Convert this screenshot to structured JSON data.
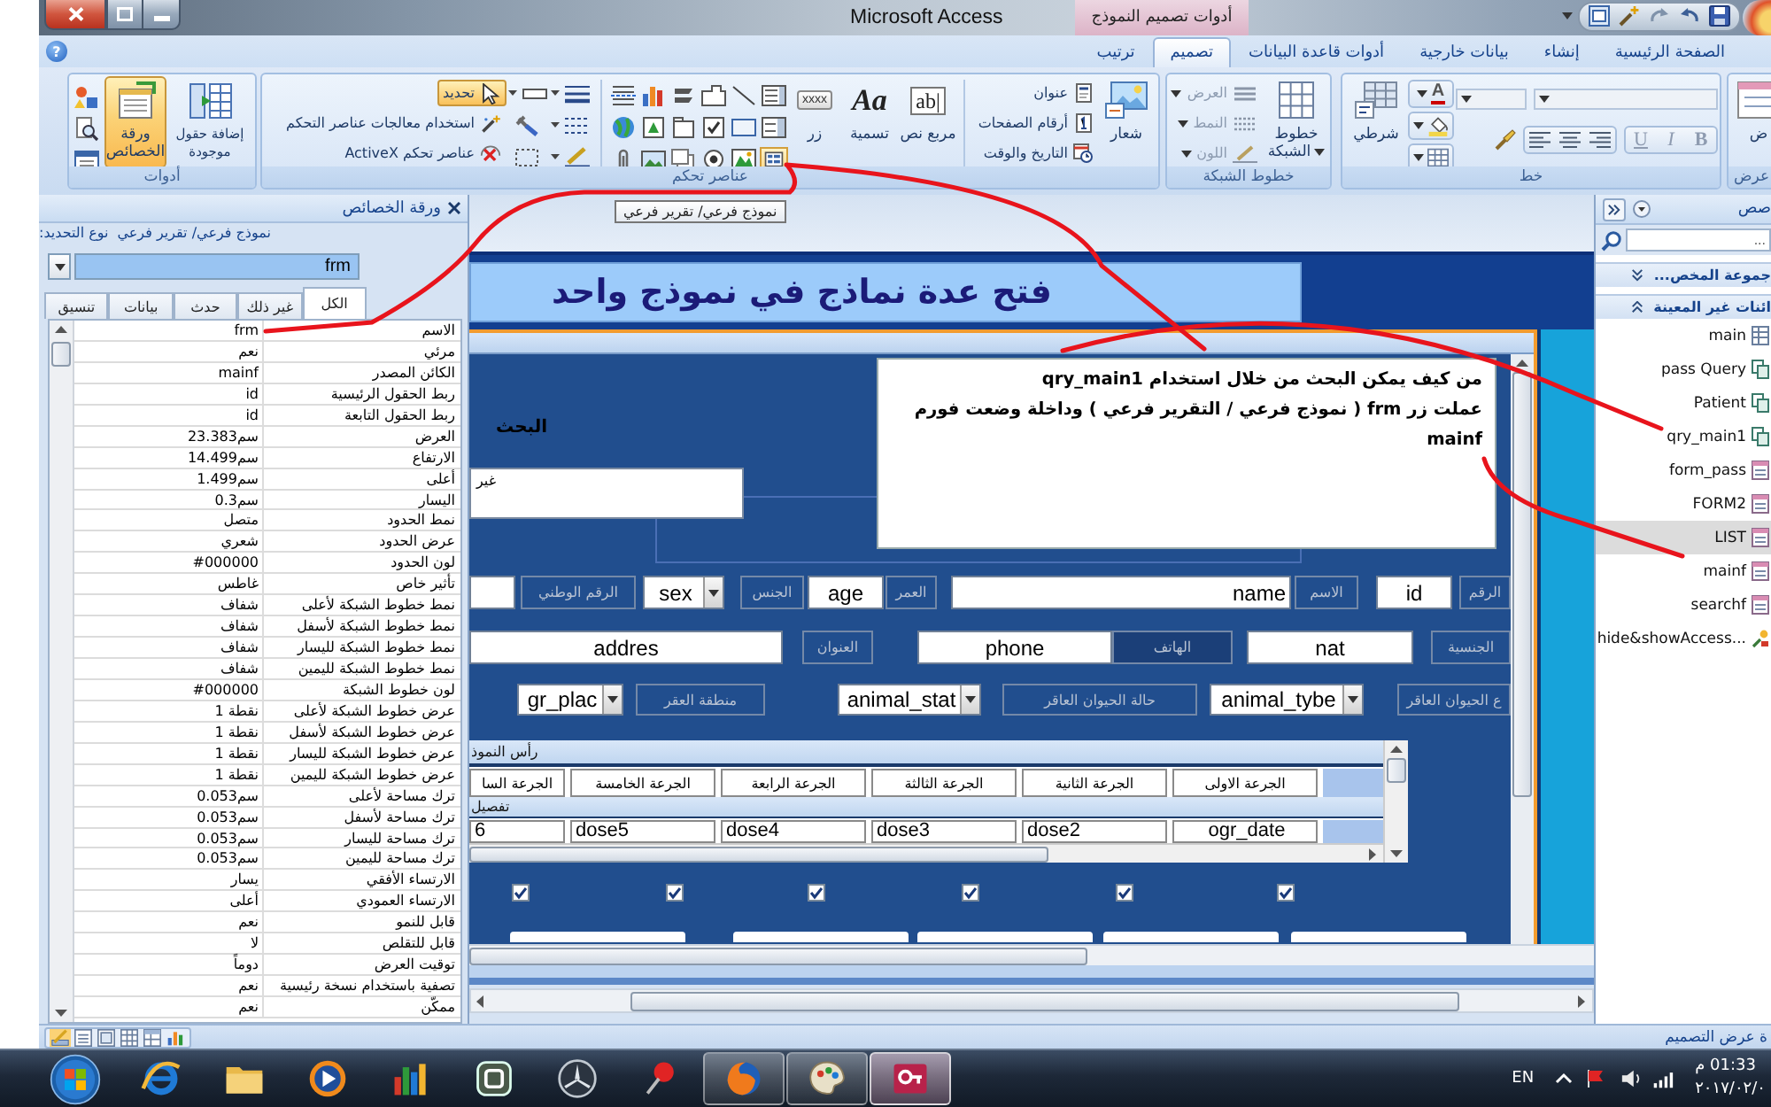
{
  "window": {
    "title": "Microsoft Access",
    "context_title": "أدوات تصميم النموذج",
    "help": "?"
  },
  "ribbon_tabs": [
    {
      "label": "الصفحة الرئيسية",
      "selected": false
    },
    {
      "label": "إنشاء",
      "selected": false
    },
    {
      "label": "بيانات خارجية",
      "selected": false
    },
    {
      "label": "أدوات قاعدة البيانات",
      "selected": false
    },
    {
      "label": "تصميم",
      "selected": true
    },
    {
      "label": "ترتيب",
      "selected": false
    }
  ],
  "ribbon": {
    "view": {
      "label": "عرض",
      "button": "ض"
    },
    "font": {
      "label": "خط",
      "conditional": "شرطي",
      "font_color": "A",
      "format": [
        {
          "label": "B",
          "disabled": true
        },
        {
          "label": "I",
          "disabled": true
        },
        {
          "label": "U",
          "disabled": true
        }
      ]
    },
    "gridlines": {
      "label": "خطوط الشبكة",
      "button": "خطوط الشبكة",
      "options": [
        {
          "label": "العرض",
          "disabled": true
        },
        {
          "label": "النمط",
          "disabled": true
        },
        {
          "label": "اللون",
          "disabled": true
        }
      ]
    },
    "controls": {
      "label": "عناصر تحكم",
      "logo": "شعار",
      "header_items": [
        "عنوان",
        "أرقام الصفحات",
        "التاريخ والوقت"
      ],
      "text_box": {
        "label": "مربع نص",
        "sample": "ab|"
      },
      "label_tool": {
        "label": "تسمية",
        "sample": "Aa"
      },
      "button_tool": {
        "label": "زر",
        "sample": "xxxx"
      },
      "select": {
        "label": "تحديد",
        "selected": true
      },
      "wizards": "استخدام معالجات عناصر التحكم",
      "activex": "عناصر تحكم ActiveX",
      "subform_tool": {
        "highlighted": true
      }
    },
    "tools": {
      "label": "أدوات",
      "add_fields": "إضافة حقول موجودة",
      "property_sheet": {
        "label": "ورقة الخصائص",
        "selected": true
      }
    }
  },
  "tooltip": "نموذج فرعي/ تقرير فرعي",
  "property_sheet": {
    "title": "ورقة الخصائص",
    "selection_type_label": "نوع التحديد:",
    "selection_type": "نموذج فرعي/ تقرير فرعي",
    "object": "frm",
    "tabs": [
      {
        "label": "الكل",
        "selected": true
      },
      {
        "label": "غير ذلك",
        "selected": false
      },
      {
        "label": "حدث",
        "selected": false
      },
      {
        "label": "بيانات",
        "selected": false
      },
      {
        "label": "تنسيق",
        "selected": false
      }
    ],
    "rows": [
      {
        "name": "الاسم",
        "value": "frm"
      },
      {
        "name": "مرئي",
        "value": "نعم"
      },
      {
        "name": "الكائن المصدر",
        "value": "mainf"
      },
      {
        "name": "ربط الحقول الرئيسية",
        "value": "id"
      },
      {
        "name": "ربط الحقول التابعة",
        "value": "id"
      },
      {
        "name": "العرض",
        "value": "23.383سم"
      },
      {
        "name": "الارتفاع",
        "value": "14.499سم"
      },
      {
        "name": "أعلى",
        "value": "1.499سم"
      },
      {
        "name": "اليسار",
        "value": "0.3سم"
      },
      {
        "name": "نمط الحدود",
        "value": "متصل"
      },
      {
        "name": "عرض الحدود",
        "value": "شعري"
      },
      {
        "name": "لون الحدود",
        "value": "#000000"
      },
      {
        "name": "تأثير خاص",
        "value": "غاطس"
      },
      {
        "name": "نمط خطوط الشبكة لأعلى",
        "value": "شفاف"
      },
      {
        "name": "نمط خطوط الشبكة لأسفل",
        "value": "شفاف"
      },
      {
        "name": "نمط خطوط الشبكة لليسار",
        "value": "شفاف"
      },
      {
        "name": "نمط خطوط الشبكة لليمين",
        "value": "شفاف"
      },
      {
        "name": "لون خطوط الشبكة",
        "value": "#000000"
      },
      {
        "name": "عرض خطوط الشبكة لأعلى",
        "value": "1 نقطة"
      },
      {
        "name": "عرض خطوط الشبكة لأسفل",
        "value": "1 نقطة"
      },
      {
        "name": "عرض خطوط الشبكة لليسار",
        "value": "1 نقطة"
      },
      {
        "name": "عرض خطوط الشبكة لليمين",
        "value": "1 نقطة"
      },
      {
        "name": "ترك مساحة لأعلى",
        "value": "0.053سم"
      },
      {
        "name": "ترك مساحة لأسفل",
        "value": "0.053سم"
      },
      {
        "name": "ترك مساحة لليسار",
        "value": "0.053سم"
      },
      {
        "name": "ترك مساحة لليمين",
        "value": "0.053سم"
      },
      {
        "name": "الارتساء الأفقي",
        "value": "يسار"
      },
      {
        "name": "الارتساء العمودي",
        "value": "أعلى"
      },
      {
        "name": "قابل للنمو",
        "value": "نعم"
      },
      {
        "name": "قابل للتقلص",
        "value": "لا"
      },
      {
        "name": "توقيت العرض",
        "value": "دوماً"
      },
      {
        "name": "تصفية باستخدام نسخة رئيسية",
        "value": "نعم"
      },
      {
        "name": "ممكّن",
        "value": "نعم"
      }
    ]
  },
  "form": {
    "title": "فتح عدة نماذج في نموذج واحد",
    "search_label": "البحث",
    "search_box": "غير",
    "note_lines": [
      "من كيف يمكن البحث من خلال استخدام qry_main1",
      "عملت زر frm ( نموذج فرعي / التقرير فرعي ) وداخلة وضعت فورم",
      "mainf"
    ],
    "control_rows": [
      [
        {
          "kind": "label",
          "text": "الرقم"
        },
        {
          "kind": "textbox",
          "text": "id"
        },
        {
          "kind": "label",
          "text": "الاسم"
        },
        {
          "kind": "textbox",
          "text": "name"
        },
        {
          "kind": "label",
          "text": "العمر"
        },
        {
          "kind": "textbox",
          "text": "age"
        },
        {
          "kind": "label",
          "text": "الجنس"
        },
        {
          "kind": "combo",
          "text": "sex"
        },
        {
          "kind": "label",
          "text": "الرقم الوطني"
        },
        {
          "kind": "textbox"
        }
      ],
      [
        {
          "kind": "label",
          "text": "الجنسية"
        },
        {
          "kind": "textbox",
          "text": "nat"
        },
        {
          "kind": "label",
          "text": "الهاتف"
        },
        {
          "kind": "textbox",
          "text": "phone"
        },
        {
          "kind": "label",
          "text": "العنوان"
        },
        {
          "kind": "textbox",
          "text": "addres"
        }
      ],
      [
        {
          "kind": "label",
          "text": "ع الحيوان العاقر"
        },
        {
          "kind": "combo",
          "text": "animal_tybe"
        },
        {
          "kind": "label",
          "text": "حالة الحيوان العاقر"
        },
        {
          "kind": "combo",
          "text": "animal_stat"
        },
        {
          "kind": "label",
          "text": "منطقة العقر"
        },
        {
          "kind": "combo",
          "text": "gr_plac"
        }
      ]
    ],
    "subform": {
      "header_bar": "رأس النموذ",
      "detail_bar": "تفصيل",
      "columns": [
        "الجرعة الاولى",
        "الجرعة الثانية",
        "الجرعة الثالثة",
        "الجرعة الرابعة",
        "الجرعة الخامسة",
        "الجرعة السا"
      ],
      "fields": [
        "ogr_date",
        "dose2",
        "dose3",
        "dose4",
        "dose5",
        "6"
      ]
    },
    "checkboxes": [
      {
        "checked": true
      },
      {
        "checked": true
      },
      {
        "checked": true
      },
      {
        "checked": true
      },
      {
        "checked": true
      },
      {
        "checked": true
      }
    ]
  },
  "nav_pane": {
    "title": "صص",
    "search_placeholder": "...",
    "groups": [
      {
        "label": "جموعة المخص...",
        "expanded": false
      },
      {
        "label": "ائنات غير المعينة",
        "expanded": true,
        "items": [
          {
            "name": "main",
            "kind": "table",
            "selected": false
          },
          {
            "name": "pass Query",
            "kind": "query",
            "selected": false
          },
          {
            "name": "Patient",
            "kind": "query",
            "selected": false
          },
          {
            "name": "qry_main1",
            "kind": "query",
            "selected": false
          },
          {
            "name": "form_pass",
            "kind": "form",
            "selected": false
          },
          {
            "name": "FORM2",
            "kind": "form",
            "selected": false
          },
          {
            "name": "LIST",
            "kind": "form",
            "selected": true
          },
          {
            "name": "mainf",
            "kind": "form",
            "selected": false
          },
          {
            "name": "searchf",
            "kind": "form",
            "selected": false
          },
          {
            "name": "hide&showAccess...",
            "kind": "macro",
            "selected": false
          }
        ]
      }
    ]
  },
  "status_bar": {
    "text": "ة عرض التصميم",
    "views": [
      {
        "selected": true
      },
      {
        "selected": false
      },
      {
        "selected": false
      },
      {
        "selected": false
      },
      {
        "selected": false
      },
      {
        "selected": false
      }
    ]
  },
  "taskbar": {
    "apps": [
      {
        "running": false,
        "active": false
      },
      {
        "running": false,
        "active": false
      },
      {
        "running": false,
        "active": false
      },
      {
        "running": false,
        "active": false
      },
      {
        "running": false,
        "active": false
      },
      {
        "running": false,
        "active": false
      },
      {
        "running": false,
        "active": false
      },
      {
        "running": true,
        "active": false
      },
      {
        "running": true,
        "active": false
      },
      {
        "running": true,
        "active": true
      }
    ],
    "language": "EN",
    "time": "01:33 م",
    "date": "٢٠١٧/٠٢/٠"
  }
}
